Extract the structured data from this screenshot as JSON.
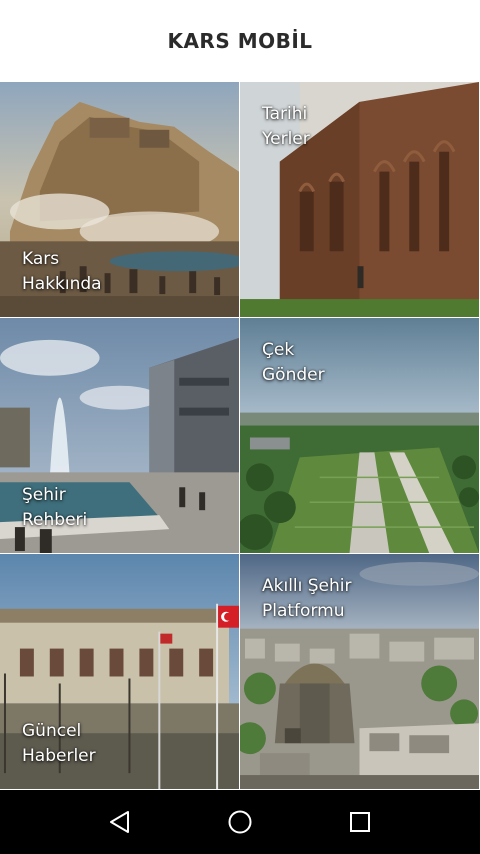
{
  "app": {
    "title": "KARS MOBİL"
  },
  "tiles": [
    {
      "label": "Kars\nHakkında"
    },
    {
      "label": "Tarihi\nYerler"
    },
    {
      "label": "Şehir\nRehberi"
    },
    {
      "label": "Çek\nGönder"
    },
    {
      "label": "Güncel\n Haberler"
    },
    {
      "label": "Akıllı Şehir\nPlatformu"
    }
  ],
  "nav": {
    "back_icon": "triangle-back-icon",
    "home_icon": "circle-home-icon",
    "recents_icon": "square-recents-icon"
  },
  "colors": {
    "header_bg": "#ffffff",
    "title": "#2b2b2b",
    "nav_bg": "#000000"
  }
}
